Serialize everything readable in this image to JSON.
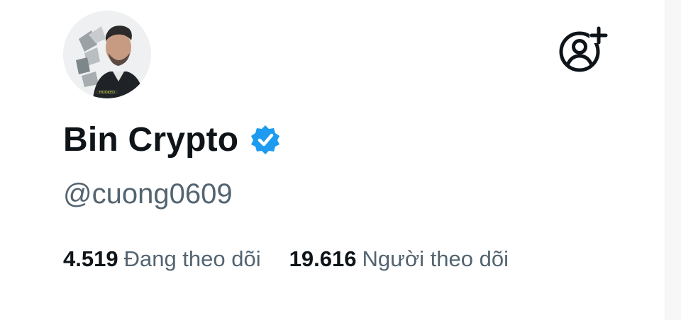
{
  "profile": {
    "display_name": "Bin Crypto",
    "handle": "@cuong0609",
    "avatar_caption": "HOOKED",
    "verified": true,
    "verified_color": "#1d9bf0"
  },
  "actions": {
    "follow_icon": "person-add-icon"
  },
  "stats": {
    "following_count": "4.519",
    "following_label": "Đang theo dõi",
    "followers_count": "19.616",
    "followers_label": "Người theo dõi"
  },
  "colors": {
    "text_primary": "#0f1419",
    "text_secondary": "#536471",
    "accent": "#1d9bf0"
  }
}
